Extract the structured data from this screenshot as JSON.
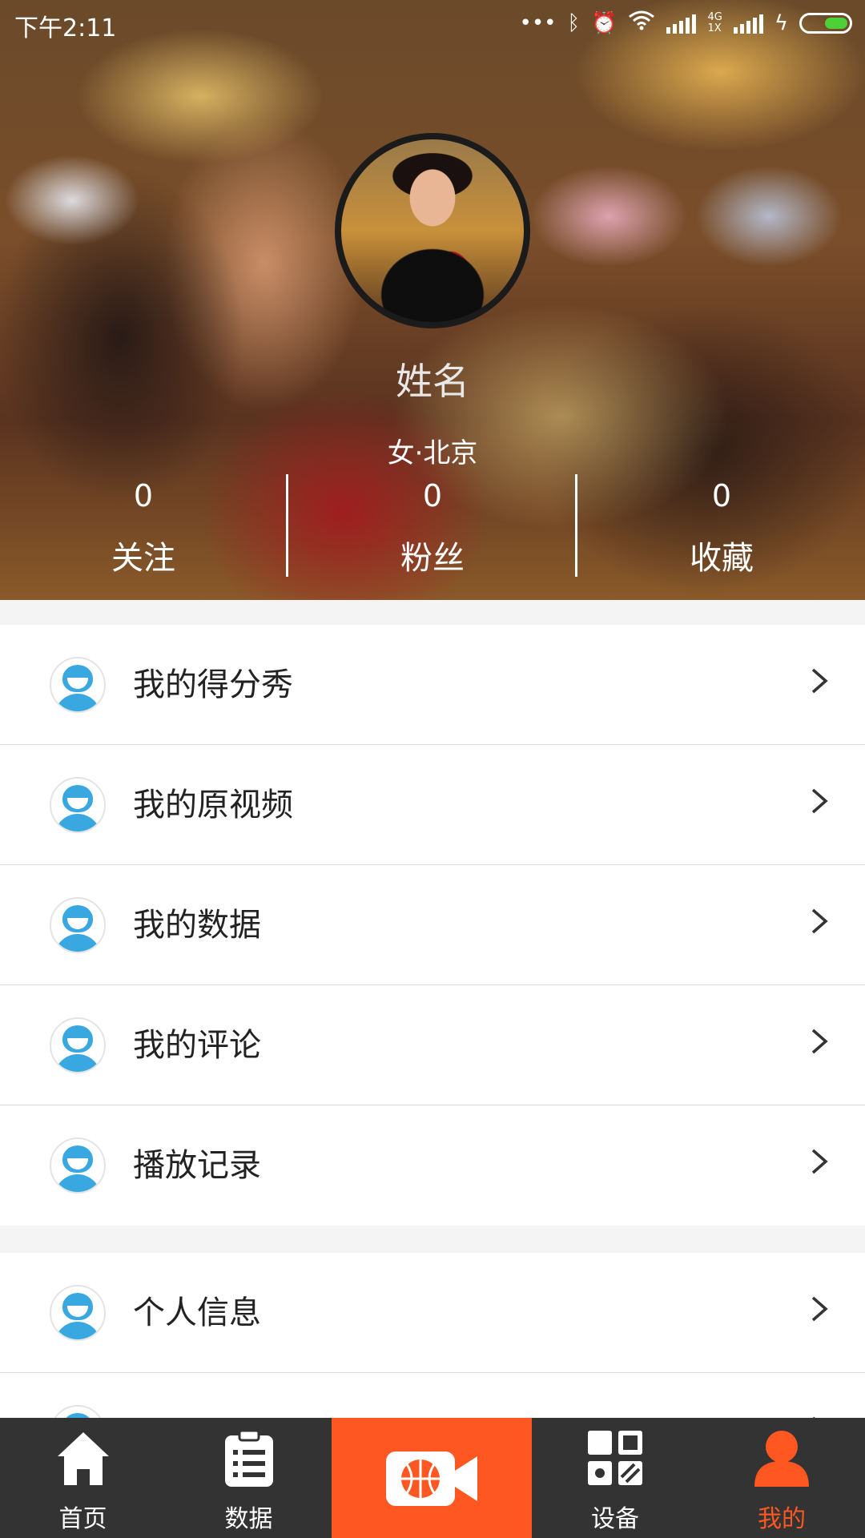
{
  "status_bar": {
    "time": "下午2:11",
    "network_top": "4G",
    "network_bottom": "1X"
  },
  "profile": {
    "name": "姓名",
    "meta": "女·北京",
    "stats": [
      {
        "count": "0",
        "label": "关注"
      },
      {
        "count": "0",
        "label": "粉丝"
      },
      {
        "count": "0",
        "label": "收藏"
      }
    ]
  },
  "menu": {
    "group1": [
      {
        "label": "我的得分秀"
      },
      {
        "label": "我的原视频"
      },
      {
        "label": "我的数据"
      },
      {
        "label": "我的评论"
      },
      {
        "label": "播放记录"
      }
    ],
    "group2": [
      {
        "label": "个人信息"
      }
    ]
  },
  "bottom_nav": {
    "items": [
      {
        "label": "首页",
        "icon": "home-icon"
      },
      {
        "label": "数据",
        "icon": "clipboard-icon"
      },
      {
        "label": "",
        "icon": "basketball-camera-icon"
      },
      {
        "label": "设备",
        "icon": "device-grid-icon"
      },
      {
        "label": "我的",
        "icon": "person-icon"
      }
    ],
    "active_color": "#ff5722",
    "center_color": "#ff5722"
  }
}
